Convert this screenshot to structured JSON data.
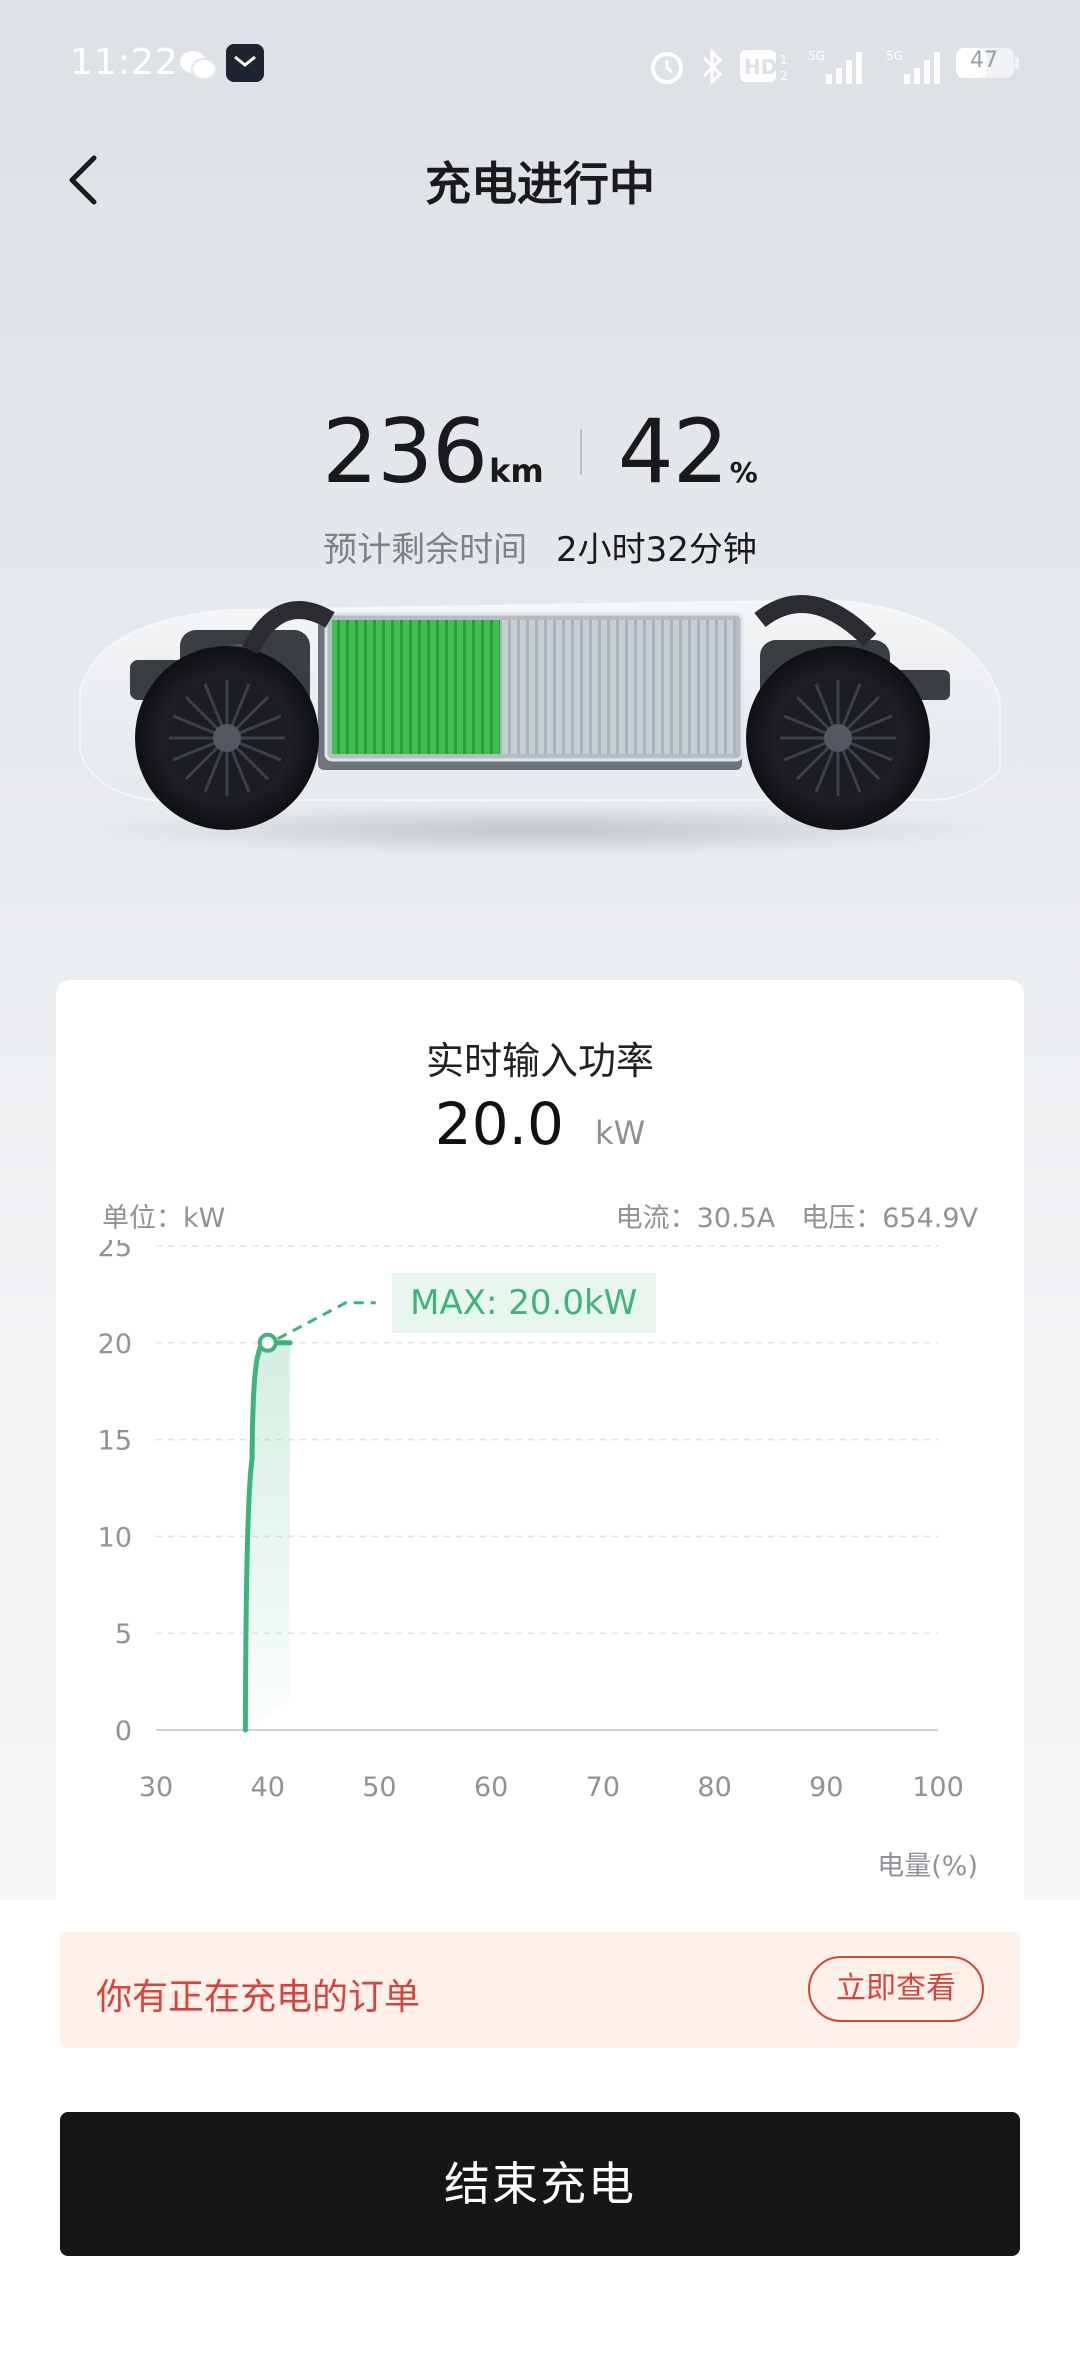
{
  "status_bar": {
    "time": "11:22",
    "battery": "47"
  },
  "header": {
    "title": "充电进行中"
  },
  "stats": {
    "range_value": "236",
    "range_unit": "km",
    "soc_value": "42",
    "soc_unit": "%",
    "eta_label": "预计剩余时间",
    "eta_value": "2小时32分钟"
  },
  "power_card": {
    "title": "实时输入功率",
    "value": "20.0",
    "unit": "kW",
    "unit_label": "单位：kW",
    "current": "电流：30.5A",
    "voltage": "电压：654.9V",
    "x_axis_label": "电量(%)",
    "max_label": "MAX: 20.0kW"
  },
  "chart_data": {
    "type": "line",
    "title": "",
    "xlabel": "电量(%)",
    "ylabel": "单位：kW",
    "xlim": [
      30,
      100
    ],
    "ylim": [
      0,
      25
    ],
    "x_ticks": [
      "30",
      "40",
      "50",
      "60",
      "70",
      "80",
      "90",
      "100"
    ],
    "y_ticks": [
      "0",
      "5",
      "10",
      "15",
      "20",
      "25"
    ],
    "grid": true,
    "series": [
      {
        "x": [
          38.0,
          38.6,
          39.2,
          40.0,
          42.0
        ],
        "y": [
          0,
          14,
          19.5,
          20.0,
          20.0
        ]
      }
    ],
    "max_marker": {
      "x": 40.0,
      "y": 20.0
    }
  },
  "notice": {
    "text": "你有正在充电的订单",
    "button_label": "立即查看"
  },
  "actions": {
    "end_label": "结束充电"
  },
  "colors": {
    "accent_green": "#3fb47a",
    "notice_red": "#d6453d",
    "notice_bg": "#fdf1ea",
    "button_dark": "#161616"
  }
}
